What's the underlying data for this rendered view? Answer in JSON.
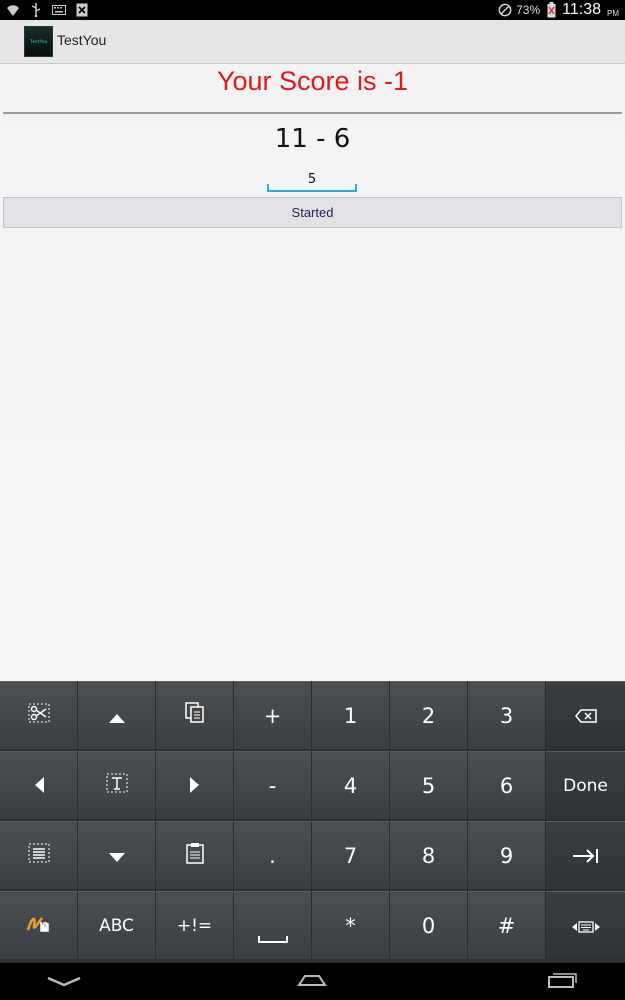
{
  "status_bar": {
    "battery": "73%",
    "time": "11:38",
    "ampm": "PM",
    "icons": [
      "wifi-icon",
      "usb-icon",
      "keyboard-icon",
      "notification-x-icon",
      "do-not-disturb-icon",
      "battery-charging-icon"
    ]
  },
  "action_bar": {
    "icon_text": "TestYou",
    "title": "TestYou"
  },
  "main": {
    "score_text": "Your Score is -1",
    "question": "11 - 6",
    "answer_value": "5",
    "start_button": "Started"
  },
  "colors": {
    "score": "#e01a1a",
    "field_underline": "#33aadd"
  },
  "keyboard": {
    "rows": [
      [
        "cut-icon",
        "arrow-up-icon",
        "copy-icon",
        "+",
        "1",
        "2",
        "3",
        "backspace-icon"
      ],
      [
        "arrow-left-icon",
        "text-select-icon",
        "arrow-right-icon",
        "-",
        "4",
        "5",
        "6",
        "Done"
      ],
      [
        "select-all-icon",
        "arrow-down-icon",
        "paste-icon",
        ".",
        "7",
        "8",
        "9",
        "tab-icon"
      ],
      [
        "handwriting-icon",
        "ABC",
        "+!=",
        "space-icon",
        "*",
        "0",
        "#",
        "keyboard-settings-icon"
      ]
    ],
    "labels": {
      "plus": "+",
      "one": "1",
      "two": "2",
      "three": "3",
      "minus": "-",
      "four": "4",
      "five": "5",
      "six": "6",
      "done": "Done",
      "dot": ".",
      "seven": "7",
      "eight": "8",
      "nine": "9",
      "abc": "ABC",
      "symbols": "+!=",
      "star": "*",
      "zero": "0",
      "hash": "#"
    }
  },
  "nav_bar": {
    "buttons": [
      "back-icon",
      "home-icon",
      "recents-icon"
    ]
  }
}
